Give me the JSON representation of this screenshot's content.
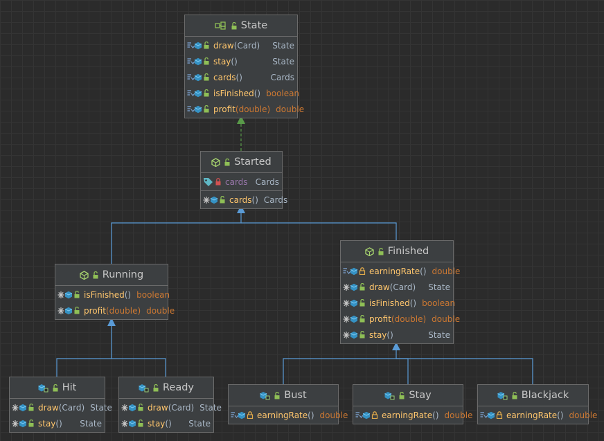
{
  "nodes": {
    "state": {
      "title": "State",
      "icon": "interface-icon",
      "sections": [
        [
          {
            "name": "draw",
            "params": "(Card)",
            "type": "State",
            "params_hl": false,
            "type_primitive": false
          },
          {
            "name": "stay",
            "params": "()",
            "type": "State",
            "params_hl": false,
            "type_primitive": false
          },
          {
            "name": "cards",
            "params": "()",
            "type": "Cards",
            "params_hl": false,
            "type_primitive": false
          },
          {
            "name": "isFinished",
            "params": "()",
            "type": "boolean",
            "params_hl": false,
            "type_primitive": true
          },
          {
            "name": "profit",
            "params": "(double)",
            "type": "double",
            "params_hl": true,
            "type_primitive": true
          }
        ]
      ]
    },
    "started": {
      "title": "Started",
      "icon": "abstract-class-icon",
      "sections": [
        [
          {
            "name": "cards",
            "params": "",
            "type": "Cards",
            "kind": "field"
          }
        ],
        [
          {
            "name": "cards",
            "params": "()",
            "type": "Cards",
            "params_hl": false,
            "type_primitive": false
          }
        ]
      ]
    },
    "running": {
      "title": "Running",
      "icon": "abstract-class-icon",
      "sections": [
        [
          {
            "name": "isFinished",
            "params": "()",
            "type": "boolean",
            "params_hl": false,
            "type_primitive": true
          },
          {
            "name": "profit",
            "params": "(double)",
            "type": "double",
            "params_hl": true,
            "type_primitive": true
          }
        ]
      ]
    },
    "finished": {
      "title": "Finished",
      "icon": "abstract-class-icon",
      "sections": [
        [
          {
            "name": "earningRate",
            "params": "()",
            "type": "double",
            "params_hl": false,
            "type_primitive": true
          },
          {
            "name": "draw",
            "params": "(Card)",
            "type": "State",
            "params_hl": false,
            "type_primitive": false
          },
          {
            "name": "isFinished",
            "params": "()",
            "type": "boolean",
            "params_hl": false,
            "type_primitive": true
          },
          {
            "name": "profit",
            "params": "(double)",
            "type": "double",
            "params_hl": true,
            "type_primitive": true
          },
          {
            "name": "stay",
            "params": "()",
            "type": "State",
            "params_hl": false,
            "type_primitive": false
          }
        ]
      ]
    },
    "hit": {
      "title": "Hit",
      "icon": "class-icon",
      "sections": [
        [
          {
            "name": "draw",
            "params": "(Card)",
            "type": "State",
            "params_hl": false,
            "type_primitive": false
          },
          {
            "name": "stay",
            "params": "()",
            "type": "State",
            "params_hl": false,
            "type_primitive": false
          }
        ]
      ]
    },
    "ready": {
      "title": "Ready",
      "icon": "class-icon",
      "sections": [
        [
          {
            "name": "draw",
            "params": "(Card)",
            "type": "State",
            "params_hl": false,
            "type_primitive": false
          },
          {
            "name": "stay",
            "params": "()",
            "type": "State",
            "params_hl": false,
            "type_primitive": false
          }
        ]
      ]
    },
    "bust": {
      "title": "Bust",
      "icon": "class-icon",
      "sections": [
        [
          {
            "name": "earningRate",
            "params": "()",
            "type": "double",
            "params_hl": false,
            "type_primitive": true
          }
        ]
      ]
    },
    "stay": {
      "title": "Stay",
      "icon": "class-icon",
      "sections": [
        [
          {
            "name": "earningRate",
            "params": "()",
            "type": "double",
            "params_hl": false,
            "type_primitive": true
          }
        ]
      ]
    },
    "blackjack": {
      "title": "Blackjack",
      "icon": "class-icon",
      "sections": [
        [
          {
            "name": "earningRate",
            "params": "()",
            "type": "double",
            "params_hl": false,
            "type_primitive": true
          }
        ]
      ]
    }
  },
  "edges": [
    {
      "from": "Started",
      "to": "State",
      "kind": "implements"
    },
    {
      "from": "Running",
      "to": "Started",
      "kind": "extends"
    },
    {
      "from": "Finished",
      "to": "Started",
      "kind": "extends"
    },
    {
      "from": "Hit",
      "to": "Running",
      "kind": "extends"
    },
    {
      "from": "Ready",
      "to": "Running",
      "kind": "extends"
    },
    {
      "from": "Bust",
      "to": "Finished",
      "kind": "extends"
    },
    {
      "from": "Stay",
      "to": "Finished",
      "kind": "extends"
    },
    {
      "from": "Blackjack",
      "to": "Finished",
      "kind": "extends"
    }
  ],
  "colors": {
    "background": "#2b2b2b",
    "node_fill": "#3c3f41",
    "node_border": "#6b6b6b",
    "extends_edge": "#5a9bd6",
    "implements_edge": "#599a49",
    "method_name": "#ffc66d",
    "field_name": "#9876aa",
    "keyword_type": "#cc7832",
    "plain_type": "#a9b7c6"
  }
}
